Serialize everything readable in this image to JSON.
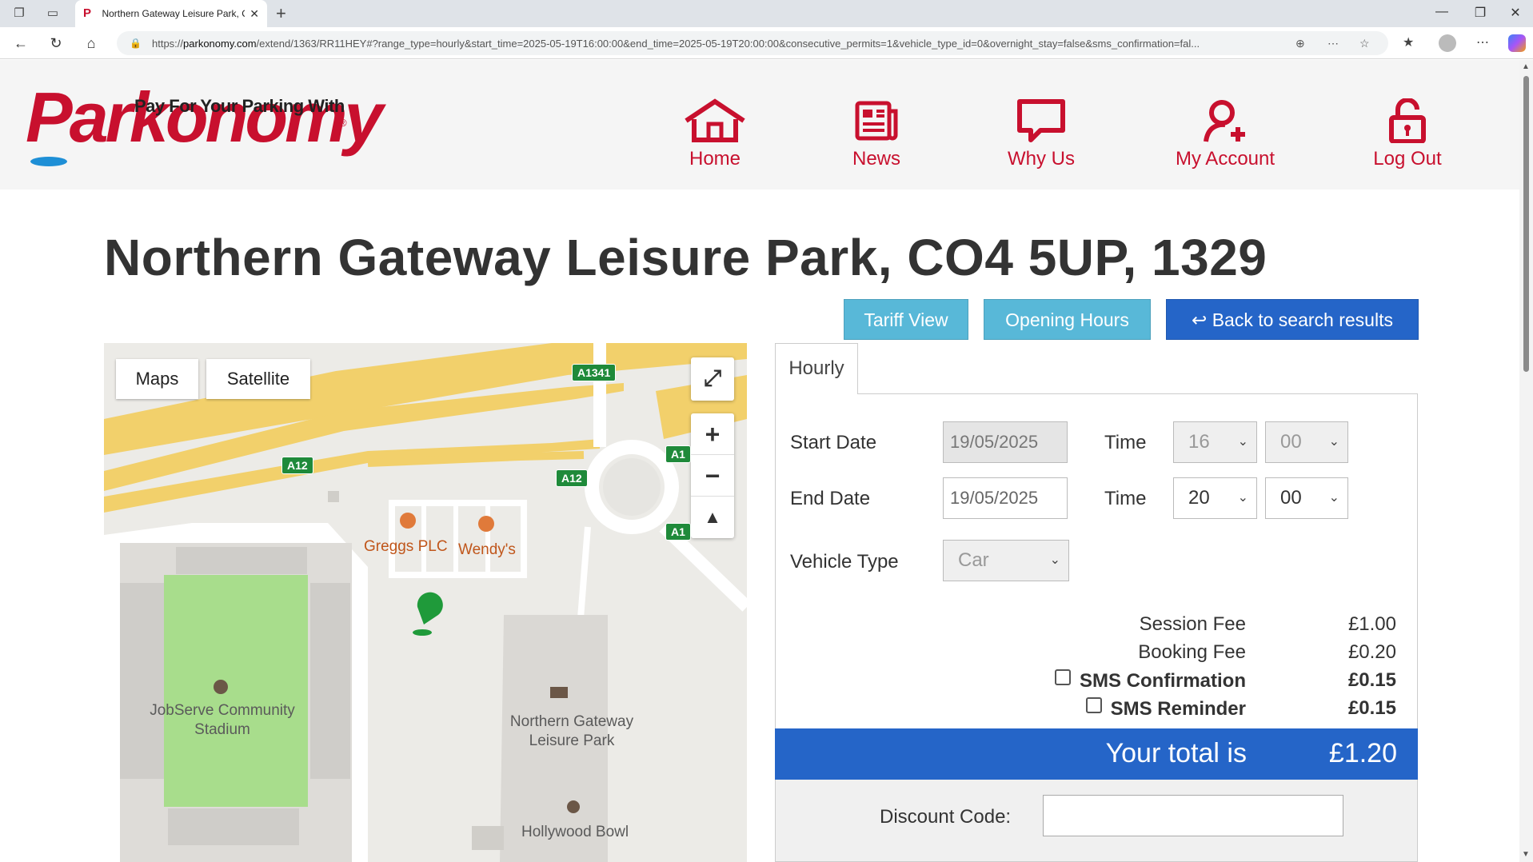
{
  "browser": {
    "tab_title": "Northern Gateway Leisure Park, C",
    "url_prefix": "https://",
    "url_host": "parkonomy.com",
    "url_rest": "/extend/1363/RR11HEY#?range_type=hourly&start_time=2025-05-19T16:00:00&end_time=2025-05-19T20:00:00&consecutive_permits=1&vehicle_type_id=0&overnight_stay=false&sms_confirmation=fal..."
  },
  "logo": {
    "tagline": "Pay For Your Parking With",
    "brand": "Parkonomy",
    "reg": "®"
  },
  "nav": [
    {
      "label": "Home"
    },
    {
      "label": "News"
    },
    {
      "label": "Why Us"
    },
    {
      "label": "My Account"
    },
    {
      "label": "Log Out"
    }
  ],
  "title": "Northern Gateway Leisure Park, CO4 5UP, 1329",
  "buttons": {
    "tariff": "Tariff View",
    "hours": "Opening Hours",
    "back": "Back to search results"
  },
  "map": {
    "toggle_maps": "Maps",
    "toggle_satellite": "Satellite",
    "zoom_in": "+",
    "zoom_out": "−",
    "labels": {
      "greggs": "Greggs PLC",
      "wendys": "Wendy's",
      "stadium_1": "JobServe Community",
      "stadium_2": "Stadium",
      "park_1": "Northern Gateway",
      "park_2": "Leisure Park",
      "bowl": "Hollywood Bowl"
    },
    "shields": {
      "a1341": "A1341",
      "a12_a": "A12",
      "a12_b": "A12",
      "a1_a": "A1",
      "a1_b": "A1"
    }
  },
  "booking": {
    "tab": "Hourly",
    "start_date_label": "Start Date",
    "start_date": "19/05/2025",
    "end_date_label": "End Date",
    "end_date": "19/05/2025",
    "time_label": "Time",
    "start_hour": "16",
    "start_min": "00",
    "end_hour": "20",
    "end_min": "00",
    "vehicle_label": "Vehicle Type",
    "vehicle": "Car"
  },
  "fees": {
    "session_label": "Session Fee",
    "session_value": "£1.00",
    "booking_label": "Booking Fee",
    "booking_value": "£0.20",
    "sms_conf_label": "SMS Confirmation",
    "sms_conf_value": "£0.15",
    "sms_rem_label": "SMS Reminder",
    "sms_rem_value": "£0.15",
    "total_label": "Your total is",
    "total_value": "£1.20"
  },
  "discount": {
    "label": "Discount Code:",
    "value": ""
  },
  "colors": {
    "brand_red": "#c8102e",
    "primary_blue": "#2565c8",
    "teal": "#58b8d8"
  }
}
